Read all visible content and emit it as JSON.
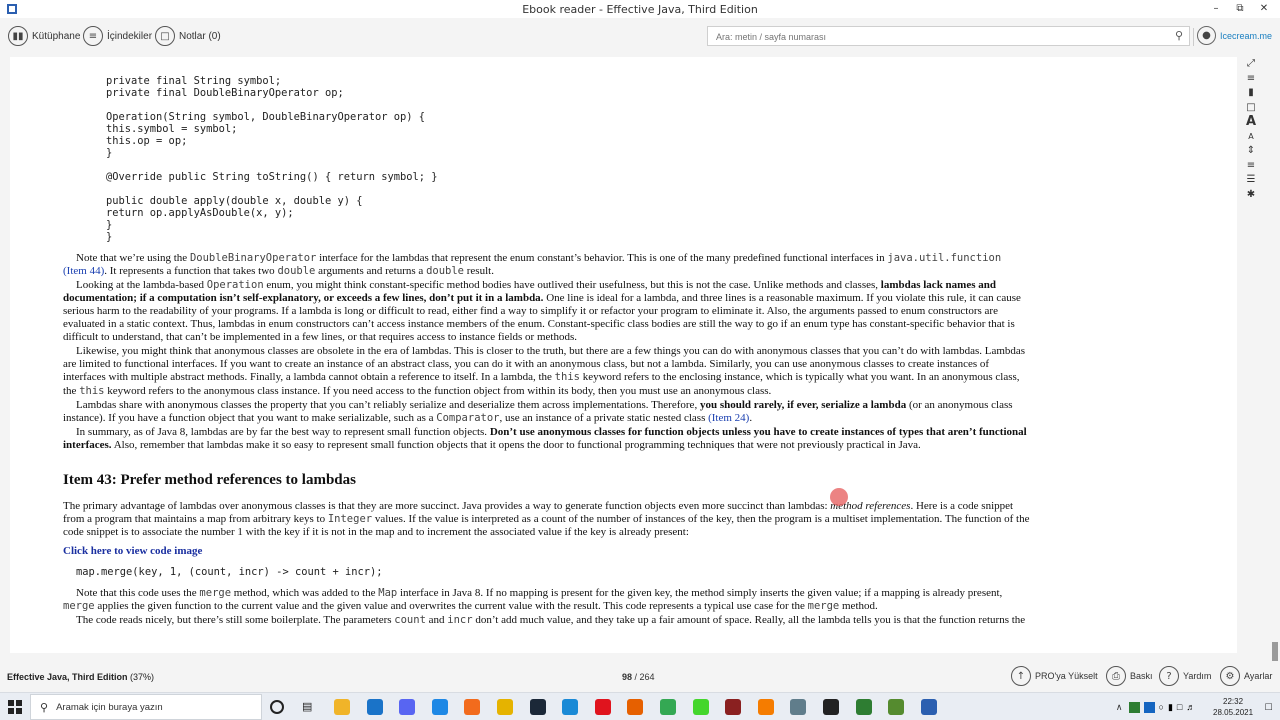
{
  "window": {
    "title": "Ebook reader - Effective Java, Third Edition",
    "controls": [
      "–",
      "⧉",
      "✕"
    ]
  },
  "toolbar": {
    "library_label": "Kütüphane",
    "toc_label": "İçindekiler",
    "notes_label": "Notlar (0)",
    "search_placeholder": "Ara: metin / sayfa numarası",
    "brand_label": "Icecream.me"
  },
  "right_tools": [
    "fullscreen-icon",
    "list-icon",
    "bookmark-icon",
    "comment-icon",
    "font-increase-icon",
    "font-decrease-icon",
    "line-spacing-icon",
    "paragraph-spacing-icon",
    "columns-icon",
    "brightness-icon"
  ],
  "content": {
    "code_block_1": [
      "    private final String symbol;",
      "    private final DoubleBinaryOperator op;",
      "",
      "    Operation(String symbol, DoubleBinaryOperator op) {",
      "        this.symbol = symbol;",
      "        this.op = op;",
      "    }",
      "",
      "    @Override public String toString() { return symbol; }",
      "",
      "    public double apply(double x, double y) {",
      "        return op.applyAsDouble(x, y);",
      "    }",
      "}"
    ],
    "p1_a": "Note that we’re using the ",
    "p1_code1": "DoubleBinaryOperator",
    "p1_b": " interface for the lambdas that represent the enum constant’s behavior. This is one of the many predefined functional interfaces in ",
    "p1_code2": "java.util.function",
    "p1_link": "(Item 44)",
    "p1_c": ". It represents a function that takes two ",
    "p1_code3": "double",
    "p1_d": " arguments and returns a ",
    "p1_code4": "double",
    "p1_e": " result.",
    "p2_a": "Looking at the lambda-based ",
    "p2_code1": "Operation",
    "p2_b": " enum, you might think constant-specific method bodies have outlived their usefulness, but this is not the case. Unlike methods and classes, ",
    "p2_bold1": "lambdas lack names and",
    "p2_bold2": "documentation; if a computation isn’t self-explanatory, or exceeds a few lines, don’t put it in a lambda.",
    "p2_c": " One line is ideal for a lambda, and three lines is a reasonable maximum. If you violate this rule, it can cause",
    "p2_l3": "serious harm to the readability of your programs. If a lambda is long or difficult to read, either find a way to simplify it or refactor your program to eliminate it. Also, the arguments passed to enum constructors are",
    "p2_l4": "evaluated in a static context. Thus, lambdas in enum constructors can’t access instance members of the enum. Constant-specific class bodies are still the way to go if an enum type has constant-specific behavior that is",
    "p2_l5": "difficult to understand, that can’t be implemented in a few lines, or that requires access to instance fields or methods.",
    "p3_l1": "Likewise, you might think that anonymous classes are obsolete in the era of lambdas. This is closer to the truth, but there are a few things you can do with anonymous classes that you can’t do with lambdas. Lambdas",
    "p3_l2": "are limited to functional interfaces. If you want to create an instance of an abstract class, you can do it with an anonymous class, but not a lambda. Similarly, you can use anonymous classes to create instances of",
    "p3_l3a": "interfaces with multiple abstract methods. Finally, a lambda cannot obtain a reference to itself. In a lambda, the ",
    "p3_code1": "this",
    "p3_l3b": " keyword refers to the enclosing instance, which is typically what you want. In an anonymous class,",
    "p3_l4a": "the ",
    "p3_code2": "this",
    "p3_l4b": " keyword refers to the anonymous class instance. If you need access to the function object from within its body, then you must use an anonymous class.",
    "p4_l1a": "Lambdas share with anonymous classes the property that you can’t reliably serialize and deserialize them across implementations. Therefore, ",
    "p4_bold": "you should rarely, if ever, serialize a lambda",
    "p4_l1b": " (or an anonymous class",
    "p4_l2a": "instance). If you have a function object that you want to make serializable, such as a ",
    "p4_code1": "Comparator",
    "p4_l2b": ", use an instance of a private static nested class ",
    "p4_link": "(Item 24)",
    "p4_l2c": ".",
    "p5_l1a": "In summary, as of Java 8, lambdas are by far the best way to represent small function objects. ",
    "p5_bold1": "Don’t use anonymous classes for function objects unless you have to create instances of types that aren’t functional",
    "p5_bold2": "interfaces.",
    "p5_l2": " Also, remember that lambdas make it so easy to represent small function objects that it opens the door to functional programming techniques that were not previously practical in Java.",
    "heading": "Item 43: Prefer method references to lambdas",
    "p6_l1a": "The primary advantage of lambdas over anonymous classes is that they are more succinct. Java provides a way to generate function objects even more succinct than lambdas: ",
    "p6_ital": "method references",
    "p6_l1b": ". Here is a code snippet",
    "p6_l2a": "from a program that maintains a map from arbitrary keys to ",
    "p6_code1": "Integer",
    "p6_l2b": " values. If the value is interpreted as a count of the number of instances of the key, then the program is a multiset implementation. The function of the",
    "p6_l3": "code snippet is to associate the number 1 with the key if it is not in the map and to increment the associated value if the key is already present:",
    "click_link": "Click here to view code image",
    "code_line": "map.merge(key, 1, (count, incr) -> count + incr);",
    "p7_l1a": "Note that this code uses the ",
    "p7_code1": "merge",
    "p7_l1b": " method, which was added to the ",
    "p7_code2": "Map",
    "p7_l1c": " interface in Java 8. If no mapping is present for the given key, the method simply inserts the given value; if a mapping is already present,",
    "p7_code3": "merge",
    "p7_l2a": " applies the given function to the current value and the given value and overwrites the current value with the result. This code represents a typical use case for the ",
    "p7_code4": "merge",
    "p7_l2b": " method.",
    "p8_a": "The code reads nicely, but there’s still some boilerplate. The parameters ",
    "p8_code1": "count",
    "p8_b": " and ",
    "p8_code2": "incr",
    "p8_c": " don’t add much value, and they take up a fair amount of space. Really, all the lambda tells you is that the function returns the"
  },
  "statusbar": {
    "book_title": "Effective Java, Third Edition",
    "progress": "(37%)",
    "current_page": "98",
    "total_pages": "/ 264",
    "upgrade_label": "PRO'ya Yükselt",
    "print_label": "Baskı",
    "help_label": "Yardım",
    "settings_label": "Ayarlar"
  },
  "taskbar": {
    "search_placeholder": "Aramak için buraya yazın",
    "time": "22:32",
    "date": "28.05.2021",
    "apps": [
      {
        "name": "file-explorer-icon",
        "color": "#f0b429"
      },
      {
        "name": "mail-icon",
        "color": "#1a73c8"
      },
      {
        "name": "discord-icon",
        "color": "#5865f2"
      },
      {
        "name": "app-icon-blue",
        "color": "#1e88e5"
      },
      {
        "name": "origin-icon",
        "color": "#f26b1d"
      },
      {
        "name": "rockstar-icon",
        "color": "#e5b300"
      },
      {
        "name": "steam-icon",
        "color": "#1b2838"
      },
      {
        "name": "edge-icon",
        "color": "#1a8ad6"
      },
      {
        "name": "opera-icon",
        "color": "#e0141e"
      },
      {
        "name": "firefox-icon",
        "color": "#e66000"
      },
      {
        "name": "chrome-icon",
        "color": "#34a853"
      },
      {
        "name": "razer-icon",
        "color": "#44d62c"
      },
      {
        "name": "app-icon-dark",
        "color": "#8a2020"
      },
      {
        "name": "app-icon-orange",
        "color": "#f57c00"
      },
      {
        "name": "app-icon-gray",
        "color": "#607d8b"
      },
      {
        "name": "app-icon-red",
        "color": "#222222"
      },
      {
        "name": "app-icon-green",
        "color": "#2e7d32"
      },
      {
        "name": "app-icon-green2",
        "color": "#558b2f"
      },
      {
        "name": "ebook-reader-icon",
        "color": "#2b5fb0"
      }
    ]
  }
}
